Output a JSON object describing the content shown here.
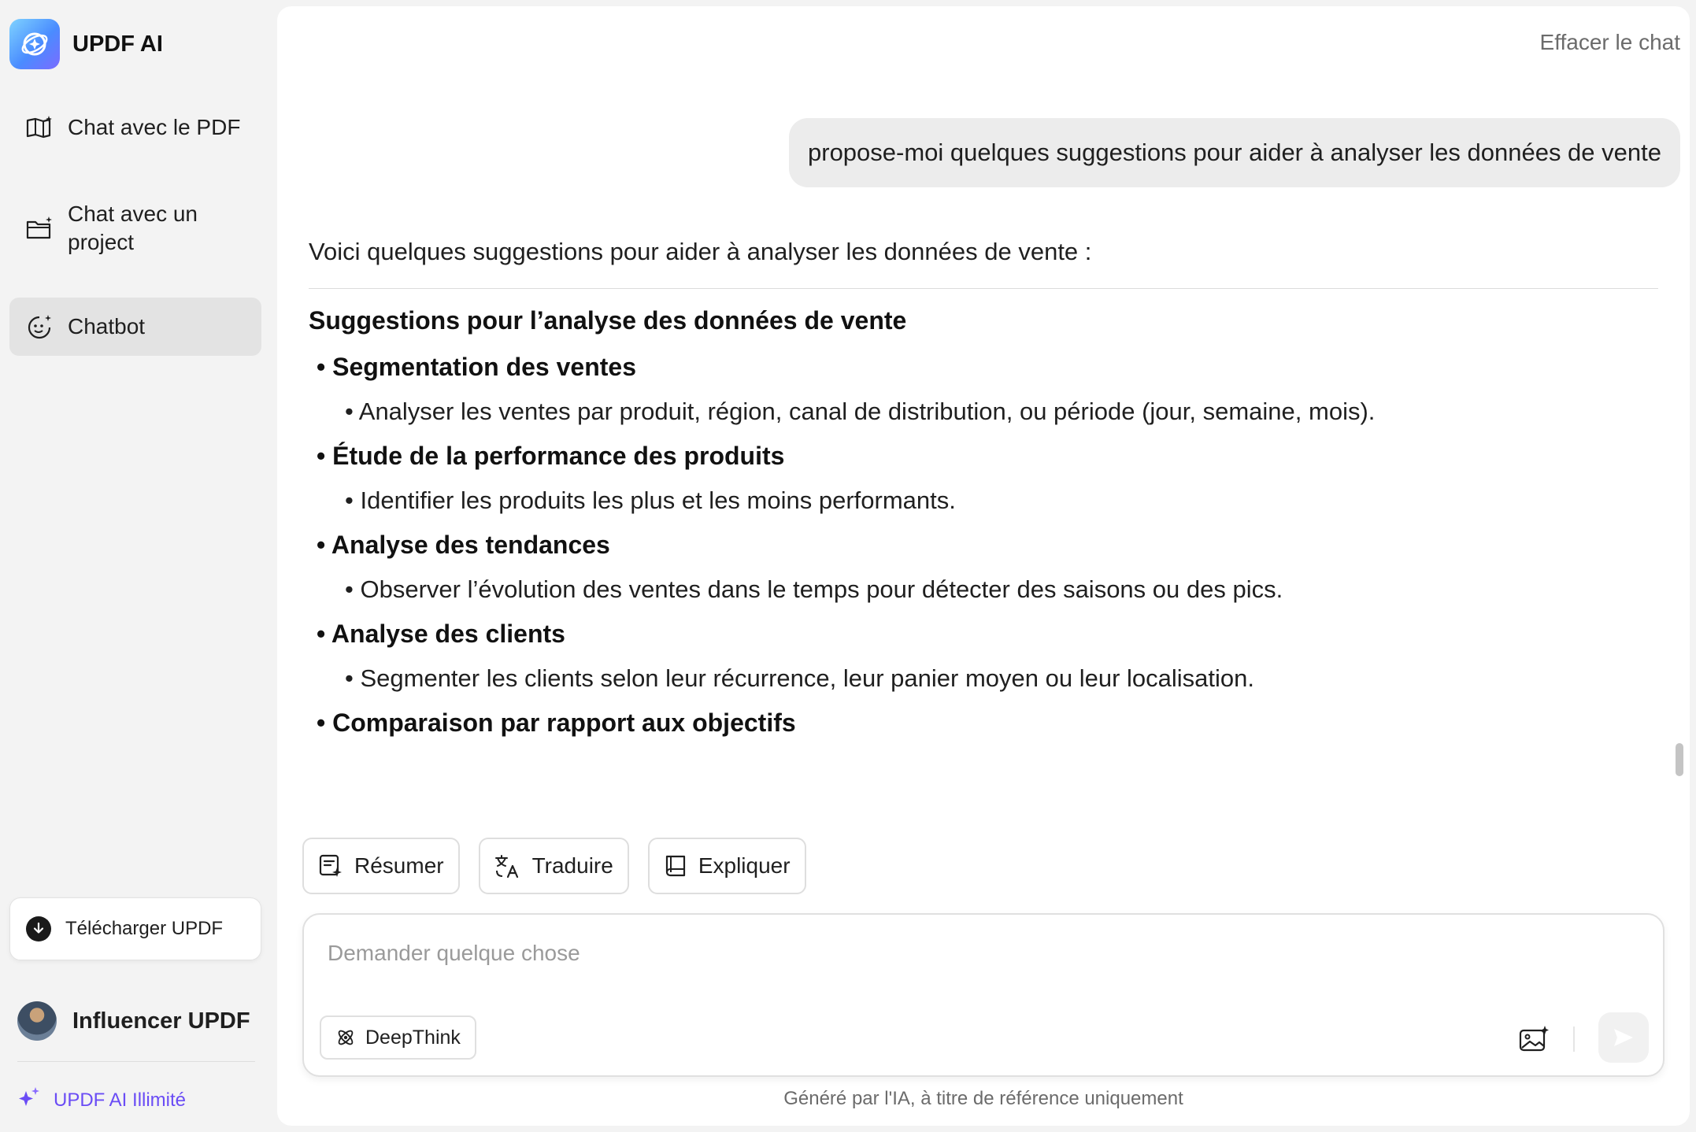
{
  "app": {
    "name": "UPDF AI"
  },
  "sidebar": {
    "nav": [
      {
        "label": "Chat avec le PDF",
        "icon": "book-sparkle-icon"
      },
      {
        "label": "Chat avec un project",
        "icon": "folder-sparkle-icon"
      },
      {
        "label": "Chatbot",
        "icon": "chatbot-face-icon",
        "active": true
      }
    ],
    "download_label": "Télécharger UPDF",
    "user_name": "Influencer UPDF",
    "plan_label": "UPDF AI Illimité",
    "accent_color": "#6a4cf5"
  },
  "header": {
    "clear_label": "Effacer le chat"
  },
  "conversation": {
    "user_message": "propose-moi quelques suggestions pour aider à analyser les données de vente",
    "intro": "Voici quelques suggestions pour aider à analyser les données de vente :",
    "heading": "Suggestions pour l’analyse des données de vente",
    "items": [
      {
        "title": "Segmentation des ventes",
        "detail": "Analyser les ventes par produit, région, canal de distribution, ou période (jour, semaine, mois)."
      },
      {
        "title": "Étude de la performance des produits",
        "detail": "Identifier les produits les plus et les moins performants."
      },
      {
        "title": "Analyse des tendances",
        "detail": "Observer l’évolution des ventes dans le temps pour détecter des saisons ou des pics."
      },
      {
        "title": "Analyse des clients",
        "detail": "Segmenter les clients selon leur récurrence, leur panier moyen ou leur localisation."
      }
    ],
    "truncated_title": "Comparaison par rapport aux objectifs"
  },
  "actions": {
    "summarize": "Résumer",
    "translate": "Traduire",
    "explain": "Expliquer"
  },
  "composer": {
    "placeholder": "Demander quelque chose",
    "value": "",
    "deepthink_label": "DeepThink"
  },
  "footer": {
    "disclaimer": "Généré par l'IA, à titre de référence uniquement"
  }
}
